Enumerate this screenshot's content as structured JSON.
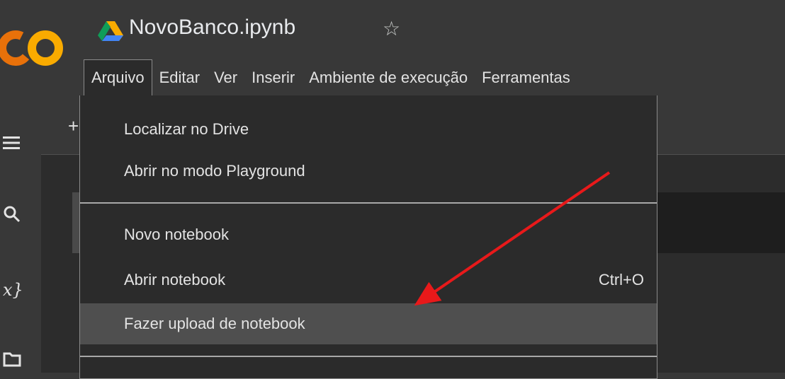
{
  "header": {
    "title": "NovoBanco.ipynb",
    "drive_icon": "google-drive-icon",
    "star_icon": "star-outline-icon",
    "logo": "colab-logo"
  },
  "menubar": {
    "items": [
      {
        "label": "Arquivo"
      },
      {
        "label": "Editar"
      },
      {
        "label": "Ver"
      },
      {
        "label": "Inserir"
      },
      {
        "label": "Ambiente de execução"
      },
      {
        "label": "Ferramentas"
      }
    ]
  },
  "sidebar": {
    "icons": [
      "menu-icon",
      "search-icon",
      "variables-icon",
      "folder-icon"
    ],
    "variables_glyph": "x}"
  },
  "toolbar": {
    "add_glyph": "+"
  },
  "file_menu": {
    "items": [
      {
        "label": "Localizar no Drive",
        "shortcut": ""
      },
      {
        "label": "Abrir no modo Playground",
        "shortcut": ""
      },
      {
        "label": "Novo notebook",
        "shortcut": ""
      },
      {
        "label": "Abrir notebook",
        "shortcut": "Ctrl+O"
      },
      {
        "label": "Fazer upload de notebook",
        "shortcut": ""
      }
    ]
  },
  "annotation": {
    "arrow_color": "#e8191a"
  },
  "colors": {
    "background": "#383838",
    "menu_background": "#2b2b2b",
    "highlight": "#4f4f4f",
    "logo_orange": "#f9ab00",
    "logo_dark_orange": "#e8710a"
  }
}
